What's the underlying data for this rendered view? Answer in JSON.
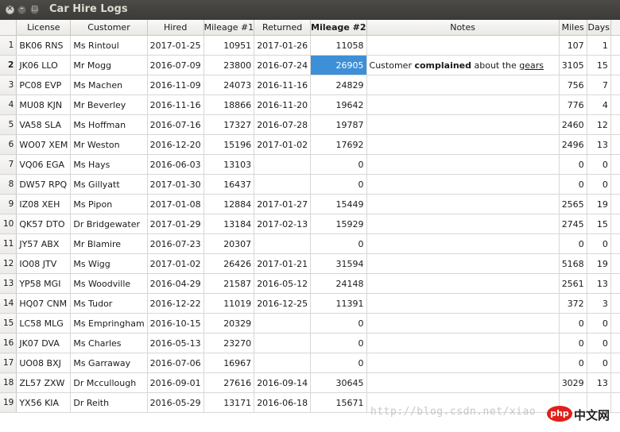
{
  "window": {
    "title": "Car Hire Logs"
  },
  "table": {
    "columns": [
      "License",
      "Customer",
      "Hired",
      "Mileage #1",
      "Returned",
      "Mileage #2",
      "Notes",
      "Miles",
      "Days"
    ],
    "rows": [
      {
        "n": "1",
        "license": "BK06 RNS",
        "customer": "Ms Rintoul",
        "hired": "2017-01-25",
        "m1": "10951",
        "returned": "2017-01-26",
        "m2": "11058",
        "notes": "",
        "miles": "107",
        "days": "1"
      },
      {
        "n": "2",
        "license": "JK06 LLO",
        "customer": "Mr Mogg",
        "hired": "2016-07-09",
        "m1": "23800",
        "returned": "2016-07-24",
        "m2": "26905",
        "notes": "",
        "miles": "3105",
        "days": "15"
      },
      {
        "n": "3",
        "license": "PC08 EVP",
        "customer": "Ms Machen",
        "hired": "2016-11-09",
        "m1": "24073",
        "returned": "2016-11-16",
        "m2": "24829",
        "notes": "",
        "miles": "756",
        "days": "7"
      },
      {
        "n": "4",
        "license": "MU08 KJN",
        "customer": "Mr Beverley",
        "hired": "2016-11-16",
        "m1": "18866",
        "returned": "2016-11-20",
        "m2": "19642",
        "notes": "",
        "miles": "776",
        "days": "4"
      },
      {
        "n": "5",
        "license": "VA58 SLA",
        "customer": "Ms Hoffman",
        "hired": "2016-07-16",
        "m1": "17327",
        "returned": "2016-07-28",
        "m2": "19787",
        "notes": "",
        "miles": "2460",
        "days": "12"
      },
      {
        "n": "6",
        "license": "WO07 XEM",
        "customer": "Mr Weston",
        "hired": "2016-12-20",
        "m1": "15196",
        "returned": "2017-01-02",
        "m2": "17692",
        "notes": "",
        "miles": "2496",
        "days": "13"
      },
      {
        "n": "7",
        "license": "VQ06 EGA",
        "customer": "Ms Hays",
        "hired": "2016-06-03",
        "m1": "13103",
        "returned": "",
        "m2": "0",
        "notes": "",
        "miles": "0",
        "days": "0"
      },
      {
        "n": "8",
        "license": "DW57 RPQ",
        "customer": "Ms Gillyatt",
        "hired": "2017-01-30",
        "m1": "16437",
        "returned": "",
        "m2": "0",
        "notes": "",
        "miles": "0",
        "days": "0"
      },
      {
        "n": "9",
        "license": "IZ08 XEH",
        "customer": "Ms Pipon",
        "hired": "2017-01-08",
        "m1": "12884",
        "returned": "2017-01-27",
        "m2": "15449",
        "notes": "",
        "miles": "2565",
        "days": "19"
      },
      {
        "n": "10",
        "license": "QK57 DTO",
        "customer": "Dr Bridgewater",
        "hired": "2017-01-29",
        "m1": "13184",
        "returned": "2017-02-13",
        "m2": "15929",
        "notes": "",
        "miles": "2745",
        "days": "15"
      },
      {
        "n": "11",
        "license": "JY57 ABX",
        "customer": "Mr Blamire",
        "hired": "2016-07-23",
        "m1": "20307",
        "returned": "",
        "m2": "0",
        "notes": "",
        "miles": "0",
        "days": "0"
      },
      {
        "n": "12",
        "license": "IO08 JTV",
        "customer": "Ms Wigg",
        "hired": "2017-01-02",
        "m1": "26426",
        "returned": "2017-01-21",
        "m2": "31594",
        "notes": "",
        "miles": "5168",
        "days": "19"
      },
      {
        "n": "13",
        "license": "YP58 MGI",
        "customer": "Ms Woodville",
        "hired": "2016-04-29",
        "m1": "21587",
        "returned": "2016-05-12",
        "m2": "24148",
        "notes": "",
        "miles": "2561",
        "days": "13"
      },
      {
        "n": "14",
        "license": "HQ07 CNM",
        "customer": "Ms Tudor",
        "hired": "2016-12-22",
        "m1": "11019",
        "returned": "2016-12-25",
        "m2": "11391",
        "notes": "",
        "miles": "372",
        "days": "3"
      },
      {
        "n": "15",
        "license": "LC58 MLG",
        "customer": "Ms Empringham",
        "hired": "2016-10-15",
        "m1": "20329",
        "returned": "",
        "m2": "0",
        "notes": "",
        "miles": "0",
        "days": "0"
      },
      {
        "n": "16",
        "license": "JK07 DVA",
        "customer": "Ms Charles",
        "hired": "2016-05-13",
        "m1": "23270",
        "returned": "",
        "m2": "0",
        "notes": "",
        "miles": "0",
        "days": "0"
      },
      {
        "n": "17",
        "license": "UO08 BXJ",
        "customer": "Ms Garraway",
        "hired": "2016-07-06",
        "m1": "16967",
        "returned": "",
        "m2": "0",
        "notes": "",
        "miles": "0",
        "days": "0"
      },
      {
        "n": "18",
        "license": "ZL57 ZXW",
        "customer": "Dr Mccullough",
        "hired": "2016-09-01",
        "m1": "27616",
        "returned": "2016-09-14",
        "m2": "30645",
        "notes": "",
        "miles": "3029",
        "days": "13"
      },
      {
        "n": "19",
        "license": "YX56 KIA",
        "customer": "Dr Reith",
        "hired": "2016-05-29",
        "m1": "13171",
        "returned": "2016-06-18",
        "m2": "15671",
        "notes": "",
        "miles": "",
        "days": ""
      }
    ],
    "rich_note": {
      "row": "2",
      "parts": [
        "Customer ",
        "complained",
        " about the ",
        "gears"
      ]
    },
    "selected_cell": {
      "row": "2",
      "column": "Mileage #2"
    },
    "current_row": "2",
    "bold_header": "Mileage #2"
  },
  "watermark": {
    "text": "http://blog.csdn.net/xiao",
    "logo_left": "php",
    "logo_right": "中文网"
  },
  "colors": {
    "selection": "#3d8fd7",
    "titlebar": "#3c3b37"
  }
}
